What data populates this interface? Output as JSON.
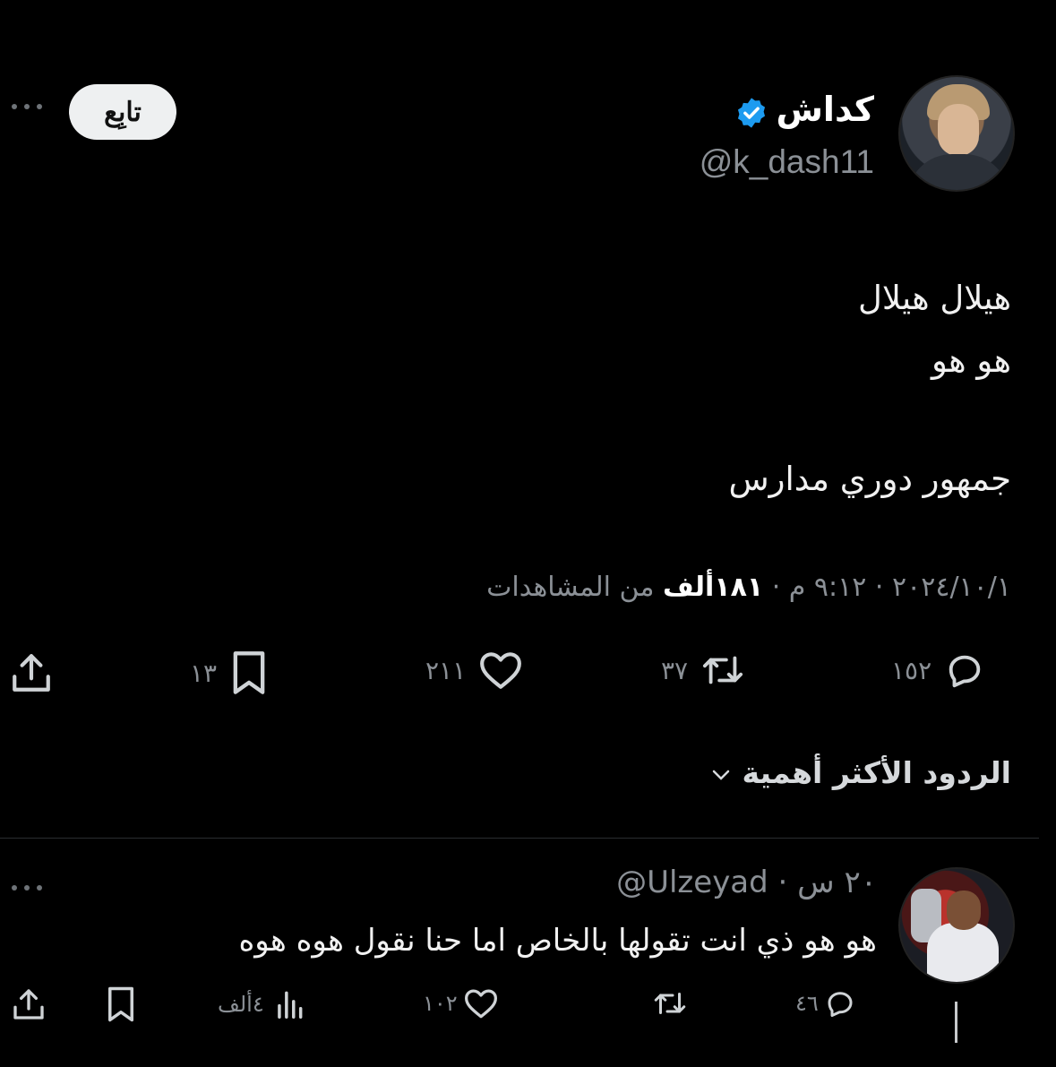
{
  "tweet": {
    "author_name": "كداش",
    "author_handle": "@k_dash11",
    "follow_label": "تابِع",
    "text_line1": "هيلال هيلال",
    "text_line2": "هو هو",
    "text_line3": "جمهور دوري مدارس",
    "meta_date": "٢٠٢٤/١٠/١ · ٩:١٢ م · ",
    "meta_views_value": "١٨١ألف",
    "meta_views_suffix": " من المشاهدات",
    "replies_count": "١٥٢",
    "retweets_count": "٣٧",
    "likes_count": "٢١١",
    "bookmarks_count": "١٣"
  },
  "replies_sort_label": "الردود الأكثر أهمية",
  "reply": {
    "handle_time": "٢٠ س · Ulzeyad@",
    "text": "هو هو ذي انت تقولها بالخاص اما حنا نقول هوه هوه",
    "replies_count": "٤٦",
    "likes_count": "١٠٢",
    "views_count": "٤ألف"
  },
  "colors": {
    "background": "#000000",
    "verified": "#1d9bf0",
    "muted": "#8b9096"
  }
}
